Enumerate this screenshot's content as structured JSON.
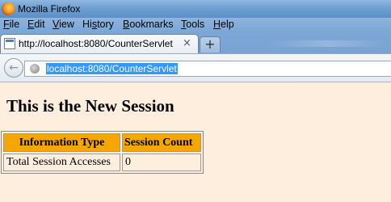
{
  "window": {
    "title": "Mozilla Firefox"
  },
  "menu": {
    "items": [
      {
        "mnemonic": "F",
        "rest": "ile"
      },
      {
        "mnemonic": "E",
        "rest": "dit"
      },
      {
        "mnemonic": "V",
        "rest": "iew"
      },
      {
        "pre": "Hi",
        "mnemonic": "s",
        "rest": "tory"
      },
      {
        "mnemonic": "B",
        "rest": "ookmarks"
      },
      {
        "mnemonic": "T",
        "rest": "ools"
      },
      {
        "mnemonic": "H",
        "rest": "elp"
      }
    ]
  },
  "tabs": {
    "active_title": "http://localhost:8080/CounterServlet",
    "close_glyph": "×",
    "new_tab_glyph": "+"
  },
  "navbar": {
    "back_glyph": "←",
    "url": "localhost:8080/CounterServlet"
  },
  "page": {
    "heading": "This is the New Session",
    "table": {
      "headers": [
        "Information Type",
        "Session Count"
      ],
      "rows": [
        [
          "Total Session Accesses",
          "0"
        ]
      ]
    }
  },
  "colors": {
    "page_background": "#fdeedd",
    "table_header_background": "#f5a700",
    "url_selection": "#3399ff"
  },
  "icons": {
    "app": "firefox-icon",
    "tab": "page-icon",
    "site": "globe-icon"
  }
}
